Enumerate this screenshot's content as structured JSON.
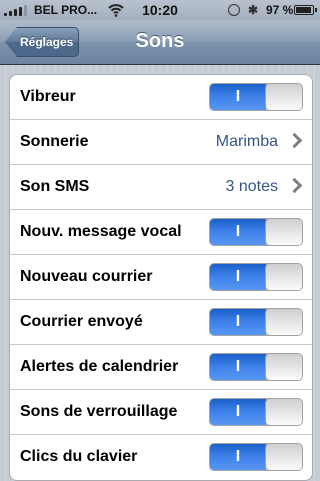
{
  "status_bar": {
    "carrier": "BEL PRO...",
    "time": "10:20",
    "battery_percent": "97 %",
    "battery_level": 0.97
  },
  "nav": {
    "back_label": "Réglages",
    "title": "Sons"
  },
  "rows": [
    {
      "label": "Vibreur",
      "type": "toggle",
      "toggle_label": "I",
      "on": true
    },
    {
      "label": "Sonnerie",
      "type": "disclosure",
      "value": "Marimba"
    },
    {
      "label": "Son SMS",
      "type": "disclosure",
      "value": "3 notes"
    },
    {
      "label": "Nouv. message vocal",
      "type": "toggle",
      "toggle_label": "I",
      "on": true
    },
    {
      "label": "Nouveau courrier",
      "type": "toggle",
      "toggle_label": "I",
      "on": true
    },
    {
      "label": "Courrier envoyé",
      "type": "toggle",
      "toggle_label": "I",
      "on": true
    },
    {
      "label": "Alertes de calendrier",
      "type": "toggle",
      "toggle_label": "I",
      "on": true
    },
    {
      "label": "Sons de verrouillage",
      "type": "toggle",
      "toggle_label": "I",
      "on": true
    },
    {
      "label": "Clics du clavier",
      "type": "toggle",
      "toggle_label": "I",
      "on": true
    }
  ],
  "colors": {
    "toggle_on": "#3f82ea",
    "value_text": "#385487",
    "nav_bar": "#7d93ab"
  }
}
